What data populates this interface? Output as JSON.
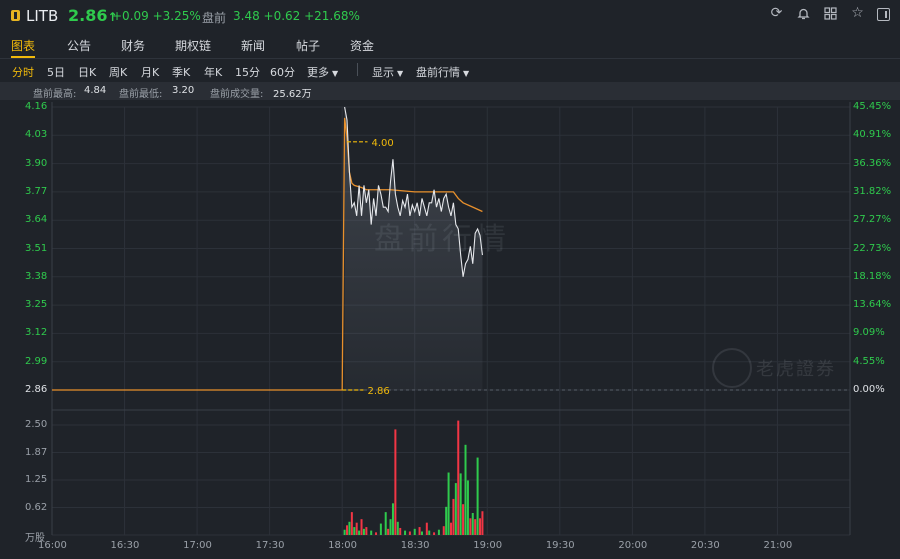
{
  "header": {
    "symbol": "LITB",
    "price": "2.86",
    "arrow": "↑",
    "change": "+0.09 +3.25%",
    "premarket_label": "盘前",
    "premarket_value": "3.48 +0.62 +21.68%",
    "icons": [
      "refresh-icon",
      "bell-icon",
      "grid-icon",
      "star-icon",
      "panel-icon"
    ]
  },
  "tabs": [
    "图表",
    "公告",
    "财务",
    "期权链",
    "新闻",
    "帖子",
    "资金"
  ],
  "periods": [
    "分时",
    "5日",
    "日K",
    "周K",
    "月K",
    "季K",
    "年K",
    "15分",
    "60分",
    "更多"
  ],
  "controls": {
    "display": "显示",
    "premarket": "盘前行情"
  },
  "info": {
    "high_label": "盘前最高:",
    "high": "4.84",
    "low_label": "盘前最低:",
    "low": "3.20",
    "vol_label": "盘前成交量:",
    "vol": "25.62万"
  },
  "price_axis": [
    "4.16",
    "4.03",
    "3.90",
    "3.77",
    "3.64",
    "3.51",
    "3.38",
    "3.25",
    "3.12",
    "2.99",
    "2.86"
  ],
  "pct_axis": [
    "45.45%",
    "40.91%",
    "36.36%",
    "31.82%",
    "27.27%",
    "22.73%",
    "18.18%",
    "13.64%",
    "9.09%",
    "4.55%",
    "0.00%"
  ],
  "volume_axis": [
    "2.50",
    "1.87",
    "1.25",
    "0.62",
    "万股"
  ],
  "time_axis": [
    "16:00",
    "16:30",
    "17:00",
    "17:30",
    "18:00",
    "18:30",
    "19:00",
    "19:30",
    "20:00",
    "20:30",
    "21:00"
  ],
  "markers": {
    "high_line": "4.00",
    "prev_close_line": "2.86"
  },
  "watermark": "盘前行情",
  "brand": "老虎證券",
  "colors": {
    "up": "#2fca4d",
    "down": "#f23645",
    "accent": "#f0b90b",
    "avg": "#e8902c"
  },
  "chart_data": {
    "type": "line",
    "x_start": "16:00",
    "x_end": "21:30",
    "ylim": [
      2.86,
      4.16
    ],
    "series": [
      {
        "values": [
          [
            960,
            2.86
          ],
          [
            1080,
            2.86
          ],
          [
            1081,
            4.16
          ],
          [
            1082,
            4.1
          ],
          [
            1083,
            3.86
          ],
          [
            1084,
            3.7
          ],
          [
            1085,
            3.72
          ],
          [
            1086,
            3.66
          ],
          [
            1087,
            3.8
          ],
          [
            1088,
            3.66
          ],
          [
            1089,
            3.8
          ],
          [
            1090,
            3.72
          ],
          [
            1091,
            3.78
          ],
          [
            1092,
            3.62
          ],
          [
            1093,
            3.74
          ],
          [
            1094,
            3.66
          ],
          [
            1095,
            3.8
          ],
          [
            1096,
            3.76
          ],
          [
            1097,
            3.7
          ],
          [
            1098,
            3.7
          ],
          [
            1099,
            3.68
          ],
          [
            1100,
            3.82
          ],
          [
            1101,
            3.92
          ],
          [
            1102,
            3.76
          ],
          [
            1103,
            3.7
          ],
          [
            1104,
            3.66
          ],
          [
            1105,
            3.73
          ],
          [
            1106,
            3.7
          ],
          [
            1107,
            3.76
          ],
          [
            1108,
            3.66
          ],
          [
            1109,
            3.71
          ],
          [
            1110,
            3.68
          ],
          [
            1111,
            3.72
          ],
          [
            1112,
            3.66
          ],
          [
            1113,
            3.74
          ],
          [
            1114,
            3.7
          ],
          [
            1115,
            3.66
          ],
          [
            1116,
            3.72
          ],
          [
            1117,
            3.72
          ],
          [
            1118,
            3.78
          ],
          [
            1119,
            3.7
          ],
          [
            1120,
            3.74
          ],
          [
            1121,
            3.68
          ],
          [
            1122,
            3.74
          ],
          [
            1123,
            3.76
          ],
          [
            1124,
            3.7
          ],
          [
            1125,
            3.66
          ],
          [
            1126,
            3.72
          ],
          [
            1127,
            3.62
          ],
          [
            1128,
            3.6
          ],
          [
            1129,
            3.48
          ],
          [
            1130,
            3.38
          ],
          [
            1131,
            3.44
          ],
          [
            1132,
            3.46
          ],
          [
            1133,
            3.52
          ],
          [
            1134,
            3.44
          ],
          [
            1135,
            3.58
          ],
          [
            1136,
            3.6
          ],
          [
            1137,
            3.57
          ],
          [
            1138,
            3.48
          ]
        ]
      },
      {
        "values": [
          [
            960,
            2.86
          ],
          [
            1080,
            2.86
          ],
          [
            1081,
            4.11
          ],
          [
            1082,
            4.02
          ],
          [
            1083,
            3.86
          ],
          [
            1084,
            3.81
          ],
          [
            1085,
            3.8
          ],
          [
            1088,
            3.79
          ],
          [
            1090,
            3.78
          ],
          [
            1093,
            3.78
          ],
          [
            1100,
            3.78
          ],
          [
            1110,
            3.77
          ],
          [
            1120,
            3.77
          ],
          [
            1126,
            3.77
          ],
          [
            1128,
            3.74
          ],
          [
            1130,
            3.72
          ],
          [
            1134,
            3.7
          ],
          [
            1138,
            3.68
          ]
        ]
      }
    ]
  },
  "volume_data": {
    "ylim": [
      0,
      2.5
    ],
    "bars": [
      [
        1081,
        0.12,
        "up"
      ],
      [
        1082,
        0.22,
        "down"
      ],
      [
        1083,
        0.3,
        "up"
      ],
      [
        1084,
        0.52,
        "down"
      ],
      [
        1085,
        0.18,
        "up"
      ],
      [
        1086,
        0.28,
        "down"
      ],
      [
        1087,
        0.1,
        "up"
      ],
      [
        1088,
        0.36,
        "down"
      ],
      [
        1089,
        0.14,
        "up"
      ],
      [
        1090,
        0.18,
        "down"
      ],
      [
        1092,
        0.1,
        "up"
      ],
      [
        1094,
        0.06,
        "down"
      ],
      [
        1096,
        0.26,
        "up"
      ],
      [
        1098,
        0.52,
        "up"
      ],
      [
        1099,
        0.14,
        "down"
      ],
      [
        1100,
        0.36,
        "up"
      ],
      [
        1101,
        0.72,
        "up"
      ],
      [
        1102,
        2.4,
        "down"
      ],
      [
        1103,
        0.3,
        "up"
      ],
      [
        1104,
        0.16,
        "down"
      ],
      [
        1106,
        0.1,
        "up"
      ],
      [
        1108,
        0.08,
        "down"
      ],
      [
        1110,
        0.14,
        "up"
      ],
      [
        1112,
        0.18,
        "down"
      ],
      [
        1113,
        0.08,
        "up"
      ],
      [
        1115,
        0.28,
        "down"
      ],
      [
        1116,
        0.1,
        "up"
      ],
      [
        1118,
        0.06,
        "down"
      ],
      [
        1120,
        0.12,
        "up"
      ],
      [
        1122,
        0.2,
        "down"
      ],
      [
        1123,
        0.64,
        "up"
      ],
      [
        1124,
        1.42,
        "up"
      ],
      [
        1125,
        0.28,
        "down"
      ],
      [
        1126,
        0.82,
        "down"
      ],
      [
        1127,
        1.18,
        "up"
      ],
      [
        1128,
        2.6,
        "down"
      ],
      [
        1129,
        1.4,
        "up"
      ],
      [
        1130,
        0.7,
        "down"
      ],
      [
        1131,
        2.05,
        "up"
      ],
      [
        1132,
        1.24,
        "up"
      ],
      [
        1133,
        0.38,
        "down"
      ],
      [
        1134,
        0.5,
        "up"
      ],
      [
        1135,
        0.36,
        "down"
      ],
      [
        1136,
        1.76,
        "up"
      ],
      [
        1137,
        0.38,
        "down"
      ],
      [
        1138,
        0.54,
        "down"
      ]
    ]
  }
}
